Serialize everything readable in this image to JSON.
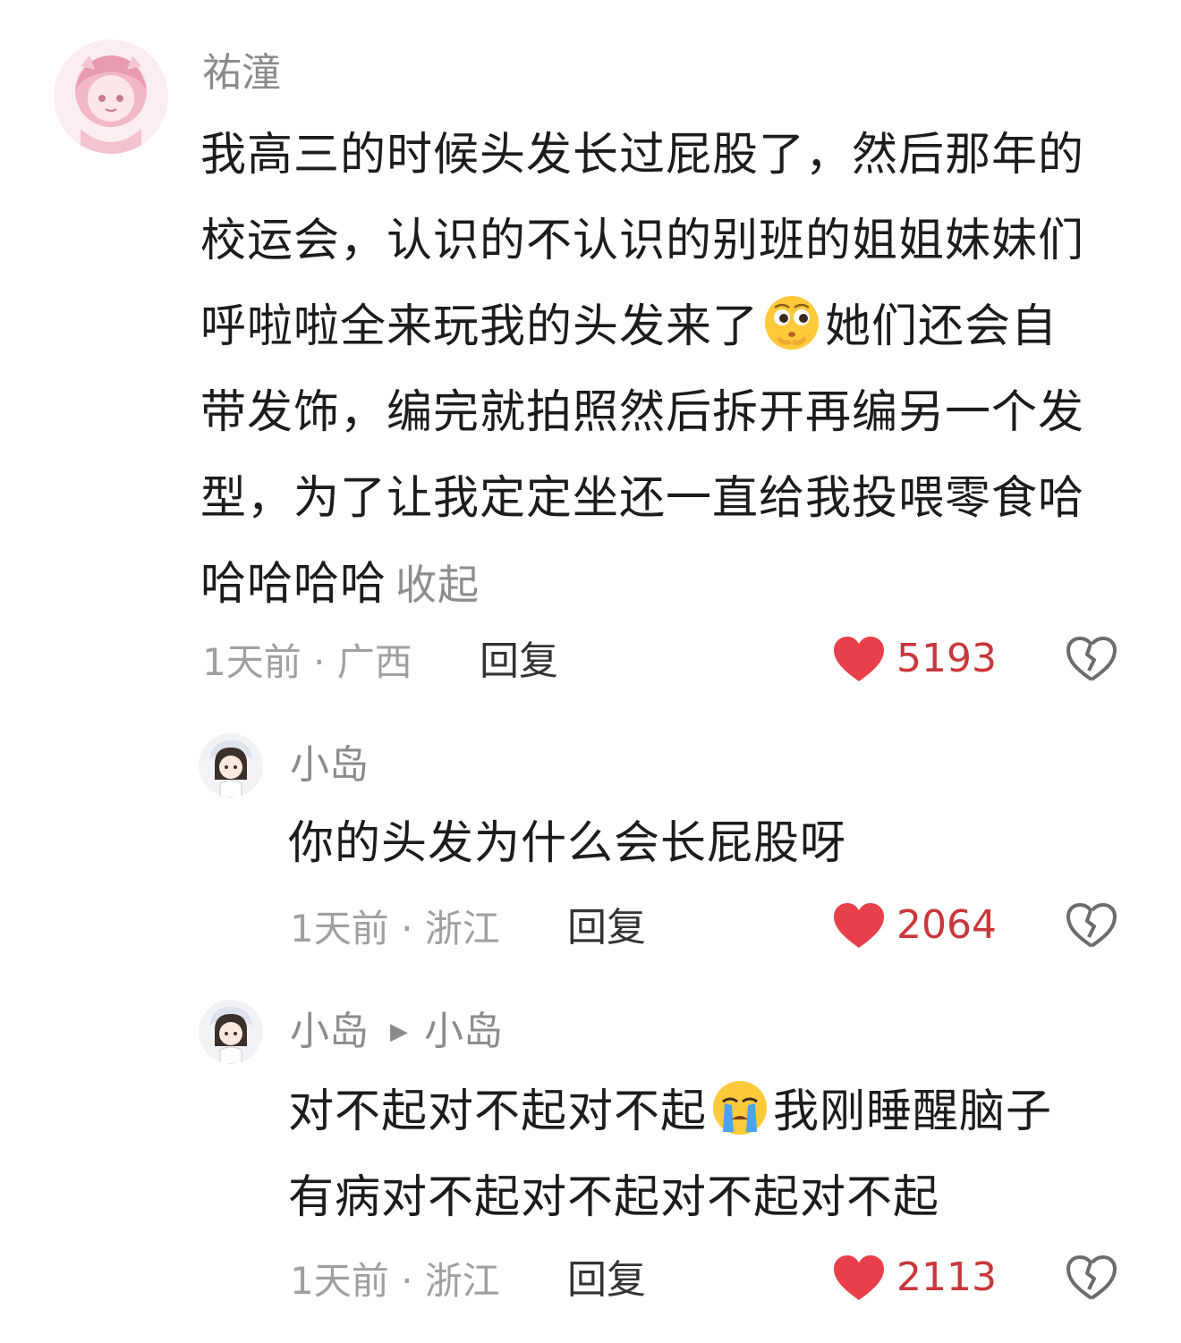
{
  "comments": [
    {
      "username": "祐潼",
      "avatar": "pink-anime-girl-avatar",
      "text_lines": [
        "我高三的时候头发长过屁股了，然后那年的",
        "校运会，认识的不认识的别班的姐姐妹妹们",
        "呼啦啦全来玩我的头发来了",
        "她们还会自",
        "带发饰，编完就拍照然后拆开再编另一个发",
        "型，为了让我定定坐还一直给我投喂零食哈",
        "哈哈哈哈"
      ],
      "inline_emoji": "shy-thinking-emoji",
      "collapse_label": "收起",
      "time": "1天前",
      "location": "广西",
      "reply_label": "回复",
      "likes": "5193"
    },
    {
      "username": "小岛",
      "avatar": "chibi-girl-avatar",
      "text": "你的头发为什么会长屁股呀",
      "time": "1天前",
      "location": "浙江",
      "reply_label": "回复",
      "likes": "2064"
    },
    {
      "username": "小岛",
      "reply_to": "小岛",
      "avatar": "chibi-girl-avatar",
      "text_lines": [
        "对不起对不起对不起",
        "我刚睡醒脑子",
        "有病对不起对不起对不起对不起"
      ],
      "inline_emoji": "crying-emoji",
      "time": "1天前",
      "location": "浙江",
      "reply_label": "回复",
      "likes": "2113"
    }
  ],
  "meta_separator": " · ",
  "colors": {
    "like_heart": "#e8404a",
    "like_count": "#c9373b",
    "meta_gray": "#a0a0a0",
    "username_gray": "#8b8b8b"
  }
}
